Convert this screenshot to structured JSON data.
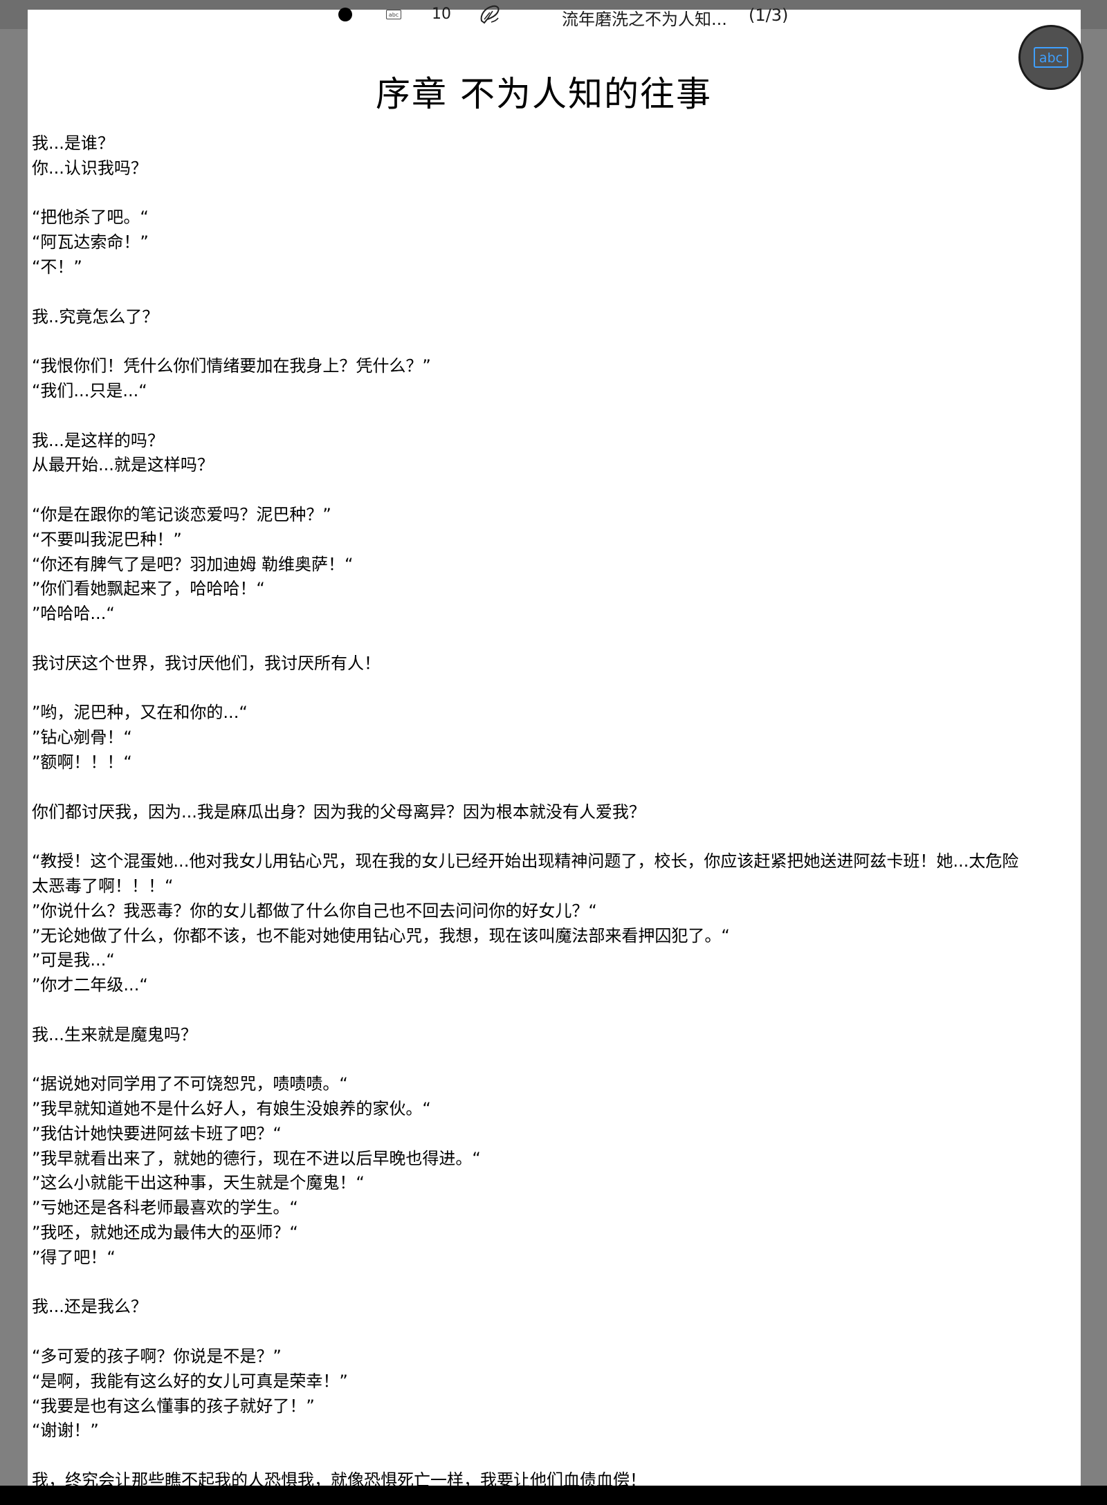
{
  "toolbar": {
    "font_size": "10",
    "document_title": "流年磨洗之不为人知...",
    "page_indicator": "(1/3)",
    "abc_label": "abc"
  },
  "fab": {
    "label": "abc"
  },
  "chapter_title": "序章 不为人知的往事",
  "lines": [
    "我...是谁？",
    "你...认识我吗？",
    "",
    "“把他杀了吧。“",
    "“阿瓦达索命！”",
    "“不！”",
    "",
    "我..究竟怎么了？",
    "",
    "“我恨你们！凭什么你们情绪要加在我身上？凭什么？”",
    "“我们...只是...“",
    "",
    "我...是这样的吗？",
    "从最开始...就是这样吗？",
    "",
    "“你是在跟你的笔记谈恋爱吗？泥巴种？”",
    "“不要叫我泥巴种！”",
    "“你还有脾气了是吧？羽加迪姆 勒维奥萨！“",
    "”你们看她飘起来了，哈哈哈！“",
    "”哈哈哈...“",
    "",
    "我讨厌这个世界，我讨厌他们，我讨厌所有人！",
    "",
    "”哟，泥巴种，又在和你的...“",
    "”钻心剜骨！“",
    "”额啊！！！“",
    "",
    "你们都讨厌我，因为...我是麻瓜出身？因为我的父母离异？因为根本就没有人爱我？",
    "",
    "“教授！这个混蛋她...他对我女儿用钻心咒，现在我的女儿已经开始出现精神问题了，校长，你应该赶紧把她送进阿兹卡班！她...太危险",
    "太恶毒了啊！！！“",
    "”你说什么？我恶毒？你的女儿都做了什么你自己也不回去问问你的好女儿？“",
    "”无论她做了什么，你都不该，也不能对她使用钻心咒，我想，现在该叫魔法部来看押囚犯了。“",
    "”可是我...“",
    "”你才二年级...“",
    "",
    "我...生来就是魔鬼吗？",
    "",
    "“据说她对同学用了不可饶恕咒，啧啧啧。“",
    "”我早就知道她不是什么好人，有娘生没娘养的家伙。“",
    "”我估计她快要进阿兹卡班了吧？“",
    "”我早就看出来了，就她的德行，现在不进以后早晚也得进。“",
    "”这么小就能干出这种事，天生就是个魔鬼！“",
    "”亏她还是各科老师最喜欢的学生。“",
    "”我呸，就她还成为最伟大的巫师？“",
    "”得了吧！“",
    "",
    "我...还是我么？",
    "",
    "“多可爱的孩子啊？你说是不是？”",
    "“是啊，我能有这么好的女儿可真是荣幸！”",
    "“我要是也有这么懂事的孩子就好了！”",
    "“谢谢！”",
    "",
    "我，终究会让那些瞧不起我的人恐惧我，就像恐惧死亡一样，我要让他们血债血偿！"
  ]
}
